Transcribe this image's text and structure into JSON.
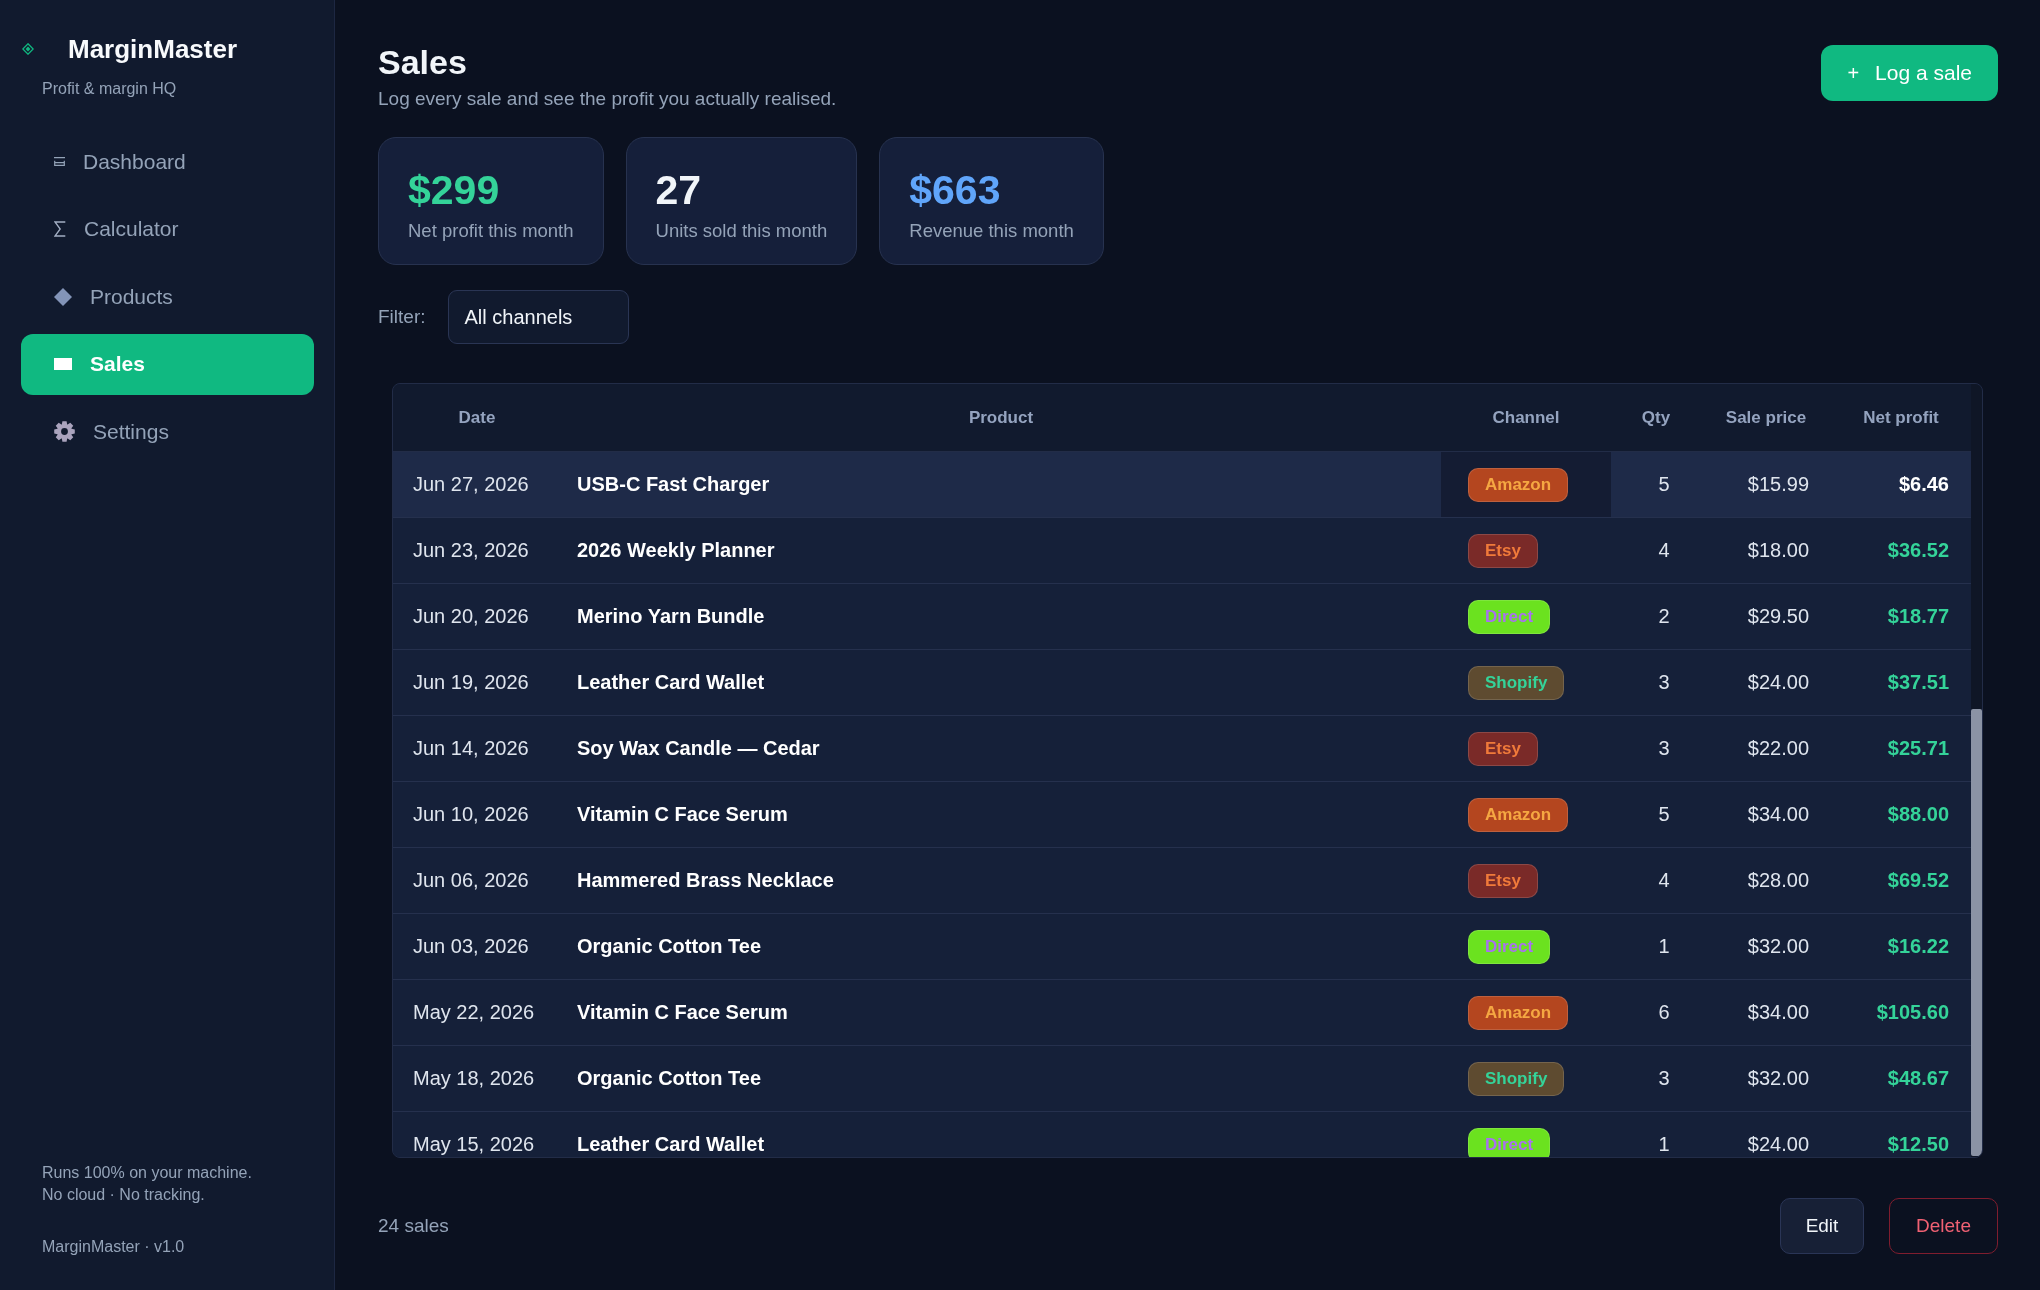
{
  "sidebar": {
    "brand": {
      "name": "MarginMaster",
      "tagline": "Profit & margin HQ"
    },
    "nav": [
      {
        "label": "Dashboard",
        "selected": false
      },
      {
        "label": "Calculator",
        "selected": false
      },
      {
        "label": "Products",
        "selected": false
      },
      {
        "label": "Sales",
        "selected": true
      },
      {
        "label": "Settings",
        "selected": false
      }
    ],
    "footer": {
      "note_lines": [
        "Runs 100% on your machine.",
        "No cloud · No tracking."
      ],
      "version": "MarginMaster · v1.0"
    }
  },
  "header": {
    "title": "Sales",
    "subtitle": "Log every sale and see the profit you actually realised.",
    "action_button": {
      "icon": "+",
      "label": "Log a sale"
    }
  },
  "stats": [
    {
      "value": "$299",
      "label": "Net profit this month",
      "color": "#34d399"
    },
    {
      "value": "27",
      "label": "Units sold this month",
      "color": "#f1f5f9"
    },
    {
      "value": "$663",
      "label": "Revenue this month",
      "color": "#60a5fa"
    }
  ],
  "filter": {
    "label": "Filter:",
    "value": "All channels"
  },
  "table": {
    "columns": [
      "Date",
      "Product",
      "Channel",
      "Qty",
      "Sale price",
      "Net profit"
    ],
    "rows": [
      {
        "date": "Jun 27, 2026",
        "product": "USB-C Fast Charger",
        "channel": {
          "label": "Amazon",
          "color": "#b4461f",
          "foreground": {
            "color": "#f5a742"
          }
        },
        "qty": "5",
        "sale_price": "$15.99",
        "net_profit": "$6.46",
        "selected": true
      },
      {
        "date": "Jun 23, 2026",
        "product": "2026 Weekly Planner",
        "channel": {
          "label": "Etsy",
          "color": "#7a2a28",
          "foreground": {
            "color": "#f07a3a"
          }
        },
        "qty": "4",
        "sale_price": "$18.00",
        "net_profit": "$36.52",
        "selected": false
      },
      {
        "date": "Jun 20, 2026",
        "product": "Merino Yarn Bundle",
        "channel": {
          "label": "Direct",
          "color": "#6be21f",
          "foreground": {
            "color": "#a970f0"
          }
        },
        "qty": "2",
        "sale_price": "$29.50",
        "net_profit": "$18.77",
        "selected": false
      },
      {
        "date": "Jun 19, 2026",
        "product": "Leather Card Wallet",
        "channel": {
          "label": "Shopify",
          "color": "#5e4b30",
          "foreground": {
            "color": "#34d399"
          }
        },
        "qty": "3",
        "sale_price": "$24.00",
        "net_profit": "$37.51",
        "selected": false
      },
      {
        "date": "Jun 14, 2026",
        "product": "Soy Wax Candle — Cedar",
        "channel": {
          "label": "Etsy",
          "color": "#7a2a28",
          "foreground": {
            "color": "#f07a3a"
          }
        },
        "qty": "3",
        "sale_price": "$22.00",
        "net_profit": "$25.71",
        "selected": false
      },
      {
        "date": "Jun 10, 2026",
        "product": "Vitamin C Face Serum",
        "channel": {
          "label": "Amazon",
          "color": "#b4461f",
          "foreground": {
            "color": "#f5a742"
          }
        },
        "qty": "5",
        "sale_price": "$34.00",
        "net_profit": "$88.00",
        "selected": false
      },
      {
        "date": "Jun 06, 2026",
        "product": "Hammered Brass Necklace",
        "channel": {
          "label": "Etsy",
          "color": "#7a2a28",
          "foreground": {
            "color": "#f07a3a"
          }
        },
        "qty": "4",
        "sale_price": "$28.00",
        "net_profit": "$69.52",
        "selected": false
      },
      {
        "date": "Jun 03, 2026",
        "product": "Organic Cotton Tee",
        "channel": {
          "label": "Direct",
          "color": "#6be21f",
          "foreground": {
            "color": "#a970f0"
          }
        },
        "qty": "1",
        "sale_price": "$32.00",
        "net_profit": "$16.22",
        "selected": false
      },
      {
        "date": "May 22, 2026",
        "product": "Vitamin C Face Serum",
        "channel": {
          "label": "Amazon",
          "color": "#b4461f",
          "foreground": {
            "color": "#f5a742"
          }
        },
        "qty": "6",
        "sale_price": "$34.00",
        "net_profit": "$105.60",
        "selected": false
      },
      {
        "date": "May 18, 2026",
        "product": "Organic Cotton Tee",
        "channel": {
          "label": "Shopify",
          "color": "#5e4b30",
          "foreground": {
            "color": "#34d399"
          }
        },
        "qty": "3",
        "sale_price": "$32.00",
        "net_profit": "$48.67",
        "selected": false
      },
      {
        "date": "May 15, 2026",
        "product": "Leather Card Wallet",
        "channel": {
          "label": "Direct",
          "color": "#6be21f",
          "foreground": {
            "color": "#a970f0"
          }
        },
        "qty": "1",
        "sale_price": "$24.00",
        "net_profit": "$12.50",
        "selected": false
      }
    ]
  },
  "footer": {
    "count": "24 sales",
    "buttons": [
      {
        "label": "Edit",
        "kind": "secondary"
      },
      {
        "label": "Delete",
        "kind": "danger"
      }
    ]
  }
}
